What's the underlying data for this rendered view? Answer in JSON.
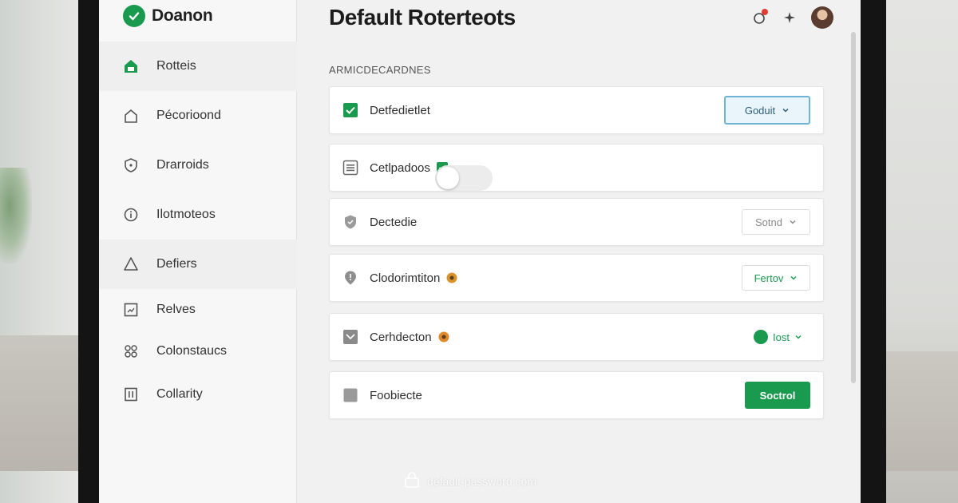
{
  "app": {
    "name": "Doanon"
  },
  "sidebar": {
    "items": [
      {
        "label": "Rotteis",
        "icon": "home-icon"
      },
      {
        "label": "Pécorioond",
        "icon": "house-outline-icon"
      },
      {
        "label": "Drarroids",
        "icon": "shield-icon"
      },
      {
        "label": "Ilotmoteos",
        "icon": "info-icon"
      },
      {
        "label": "Defiers",
        "icon": "warning-icon"
      },
      {
        "label": "Relves",
        "icon": "chart-icon"
      },
      {
        "label": "Colonstaucs",
        "icon": "people-icon"
      },
      {
        "label": "Collarity",
        "icon": "document-icon"
      }
    ]
  },
  "header": {
    "title": "Default Roterteots",
    "icons": [
      "notification-icon",
      "sparkle-icon",
      "avatar"
    ]
  },
  "section": {
    "label": "ARMICDECARDNES"
  },
  "settings": [
    {
      "label": "Detfedietlet",
      "icon": "checkbox-checked-icon",
      "control": "dropdown",
      "value": "Goduit"
    },
    {
      "label": "Cetlpadoos",
      "icon": "list-icon",
      "control": "toggle",
      "state": "off"
    },
    {
      "label": "Dectedie",
      "icon": "shield-icon",
      "control": "dropdown",
      "value": "Sotnd"
    },
    {
      "label": "Clodorimtiton",
      "icon": "location-icon",
      "control": "dropdown",
      "value": "Fertov"
    },
    {
      "label": "Cerhdecton",
      "icon": "checkbox-icon",
      "control": "status-select",
      "value": "Iost"
    },
    {
      "label": "Foobiecte",
      "icon": "square-icon",
      "control": "button",
      "value": "Soctrol"
    }
  ],
  "watermark": "default-password.com",
  "colors": {
    "accent": "#1a9a4e",
    "info": "#6fb3d6"
  }
}
